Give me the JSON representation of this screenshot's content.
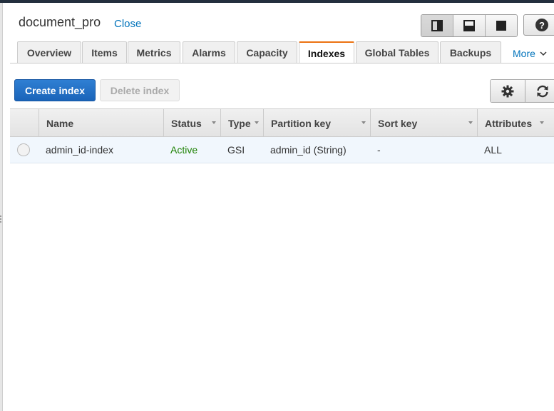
{
  "header": {
    "title": "document_pro",
    "close_label": "Close"
  },
  "layout_buttons": [
    "split-vertical-icon",
    "split-horizontal-icon",
    "full-icon"
  ],
  "help_icon": "?",
  "tabs": [
    {
      "label": "Overview",
      "active": false
    },
    {
      "label": "Items",
      "active": false
    },
    {
      "label": "Metrics",
      "active": false
    },
    {
      "label": "Alarms",
      "active": false
    },
    {
      "label": "Capacity",
      "active": false
    },
    {
      "label": "Indexes",
      "active": true
    },
    {
      "label": "Global Tables",
      "active": false
    },
    {
      "label": "Backups",
      "active": false
    }
  ],
  "more_label": "More",
  "toolbar": {
    "create_label": "Create index",
    "delete_label": "Delete index"
  },
  "table": {
    "columns": [
      "Name",
      "Status",
      "Type",
      "Partition key",
      "Sort key",
      "Attributes"
    ],
    "rows": [
      {
        "name": "admin_id-index",
        "status": "Active",
        "type": "GSI",
        "partition_key": "admin_id (String)",
        "sort_key": "-",
        "attributes": "ALL"
      }
    ]
  },
  "colors": {
    "accent": "#0073bb",
    "primary_button": "#1a64b9",
    "active_tab": "#ec7211",
    "status_active": "#1d8102"
  }
}
